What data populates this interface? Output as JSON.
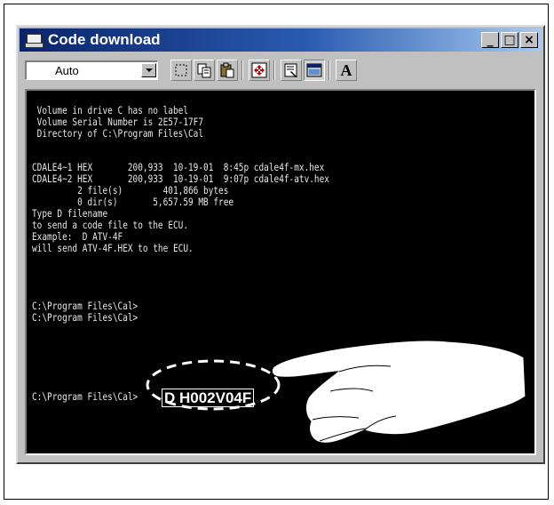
{
  "window": {
    "title": "Code download",
    "controls": {
      "minimize": "_",
      "maximize": "□",
      "close": "×"
    }
  },
  "toolbar": {
    "font_size_value": "Auto",
    "font_button_label": "A",
    "icons": [
      "mark-icon",
      "copy-icon",
      "paste-icon",
      "fullscreen-icon",
      "properties-icon",
      "background-icon",
      "font-icon"
    ]
  },
  "console": {
    "lines": [
      " Volume in drive C has no label",
      " Volume Serial Number is 2E57-17F7",
      " Directory of C:\\Program Files\\Cal",
      "",
      "CDALE4~1 HEX       200,933  10-19-01  8:45p cdale4f-mx.hex",
      "CDALE4~2 HEX       200,933  10-19-01  9:07p cdale4f-atv.hex",
      "         2 file(s)        401,866 bytes",
      "         0 dir(s)       5,657.59 MB free",
      "Type D filename",
      "to send a code file to the ECU.",
      "Example:  D ATV-4F",
      "will send ATV-4F.HEX to the ECU.",
      "",
      "",
      "C:\\Program Files\\Cal>",
      "C:\\Program Files\\Cal>",
      "",
      "C:\\Program Files\\Cal>"
    ],
    "typed_command": "D H002V04F"
  },
  "colors": {
    "titlebar_start": "#0a246a",
    "titlebar_end": "#a6caf0",
    "console_bg": "#000000",
    "console_text": "#e8e8e8",
    "window_face": "#c0c0c0"
  }
}
